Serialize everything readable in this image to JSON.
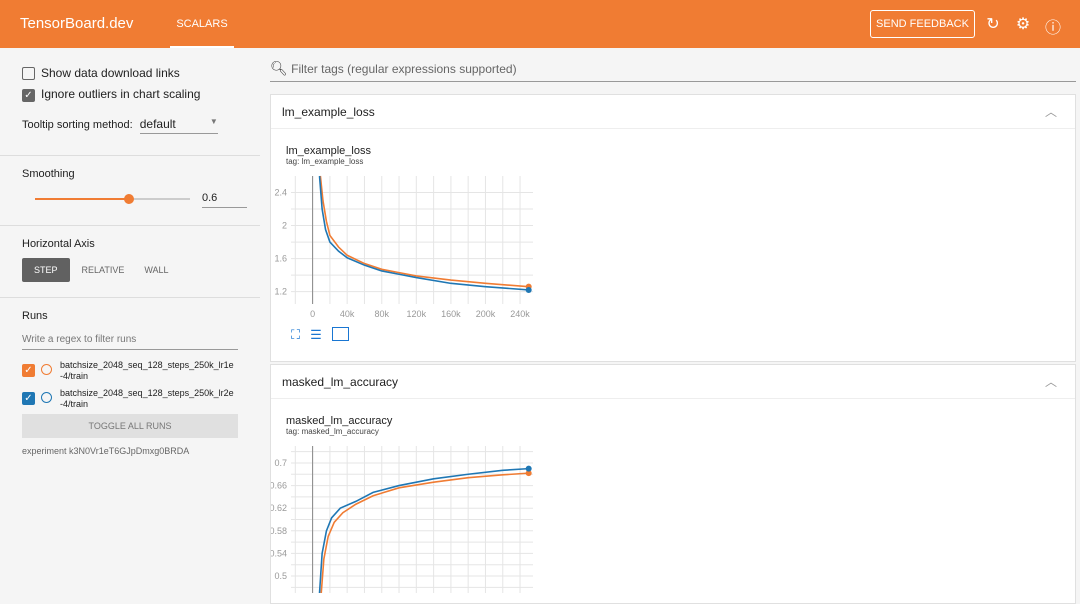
{
  "header": {
    "brand": "TensorBoard.dev",
    "tab": "SCALARS",
    "feedback": "SEND FEEDBACK"
  },
  "sidebar": {
    "show_download": "Show data download links",
    "ignore_outliers": "Ignore outliers in chart scaling",
    "tooltip_label": "Tooltip sorting method:",
    "tooltip_value": "default",
    "smoothing_label": "Smoothing",
    "smoothing_value": "0.6",
    "smoothing_fraction": 0.6,
    "haxis_label": "Horizontal Axis",
    "haxis_options": [
      "STEP",
      "RELATIVE",
      "WALL"
    ],
    "runs_label": "Runs",
    "runs_placeholder": "Write a regex to filter runs",
    "runs": [
      {
        "name": "batchsize_2048_seq_128_steps_250k_lr1e-4/train",
        "line1": "batchsize_2048_seq_128_steps_250k_lr1e",
        "line2": "-4/train",
        "color": "#f07c33"
      },
      {
        "name": "batchsize_2048_seq_128_steps_250k_lr2e-4/train",
        "line1": "batchsize_2048_seq_128_steps_250k_lr2e",
        "line2": "-4/train",
        "color": "#1f77b4"
      }
    ],
    "toggle": "TOGGLE ALL RUNS",
    "experiment": "experiment k3N0Vr1eT6GJpDmxg0BRDA"
  },
  "filter_placeholder": "Filter tags (regular expressions supported)",
  "cards": [
    {
      "header": "lm_example_loss",
      "title": "lm_example_loss",
      "tag": "tag: lm_example_loss"
    },
    {
      "header": "masked_lm_accuracy",
      "title": "masked_lm_accuracy",
      "tag": "tag: masked_lm_accuracy"
    }
  ],
  "chart_data": [
    {
      "type": "line",
      "title": "lm_example_loss",
      "xlim": [
        -25000,
        255000
      ],
      "ylim": [
        1.05,
        2.6
      ],
      "xticks": [
        "0",
        "40k",
        "80k",
        "120k",
        "160k",
        "200k",
        "240k"
      ],
      "xtickvals": [
        0,
        40000,
        80000,
        120000,
        160000,
        200000,
        240000
      ],
      "yticks": [
        "1.2",
        "1.6",
        "2",
        "2.4"
      ],
      "ytickvals": [
        1.2,
        1.6,
        2,
        2.4
      ],
      "series": [
        {
          "name": "lr1e-4",
          "color": "#f07c33",
          "x": [
            9000,
            12000,
            16000,
            20000,
            30000,
            40000,
            60000,
            80000,
            100000,
            120000,
            160000,
            200000,
            250000
          ],
          "y": [
            2.6,
            2.3,
            2.05,
            1.88,
            1.74,
            1.64,
            1.54,
            1.47,
            1.43,
            1.39,
            1.34,
            1.3,
            1.26
          ]
        },
        {
          "name": "lr2e-4",
          "color": "#1f77b4",
          "x": [
            8000,
            11000,
            15000,
            20000,
            30000,
            40000,
            60000,
            80000,
            100000,
            120000,
            160000,
            200000,
            250000
          ],
          "y": [
            2.6,
            2.2,
            1.95,
            1.8,
            1.69,
            1.61,
            1.52,
            1.45,
            1.41,
            1.37,
            1.3,
            1.26,
            1.22
          ]
        }
      ]
    },
    {
      "type": "line",
      "title": "masked_lm_accuracy",
      "xlim": [
        -25000,
        255000
      ],
      "ylim": [
        0.47,
        0.73
      ],
      "yticks": [
        "0.5",
        "0.54",
        "0.58",
        "0.62",
        "0.66",
        "0.7"
      ],
      "ytickvals": [
        0.5,
        0.54,
        0.58,
        0.62,
        0.66,
        0.7
      ],
      "series": [
        {
          "name": "lr1e-4",
          "color": "#f07c33",
          "x": [
            10000,
            13000,
            18000,
            25000,
            35000,
            50000,
            70000,
            100000,
            140000,
            180000,
            220000,
            250000
          ],
          "y": [
            0.47,
            0.53,
            0.57,
            0.595,
            0.612,
            0.627,
            0.642,
            0.656,
            0.666,
            0.674,
            0.679,
            0.682
          ]
        },
        {
          "name": "lr2e-4",
          "color": "#1f77b4",
          "x": [
            8000,
            11000,
            16000,
            22000,
            32000,
            50000,
            70000,
            100000,
            140000,
            180000,
            220000,
            250000
          ],
          "y": [
            0.47,
            0.54,
            0.58,
            0.603,
            0.62,
            0.632,
            0.648,
            0.66,
            0.672,
            0.68,
            0.687,
            0.69
          ]
        }
      ]
    }
  ]
}
